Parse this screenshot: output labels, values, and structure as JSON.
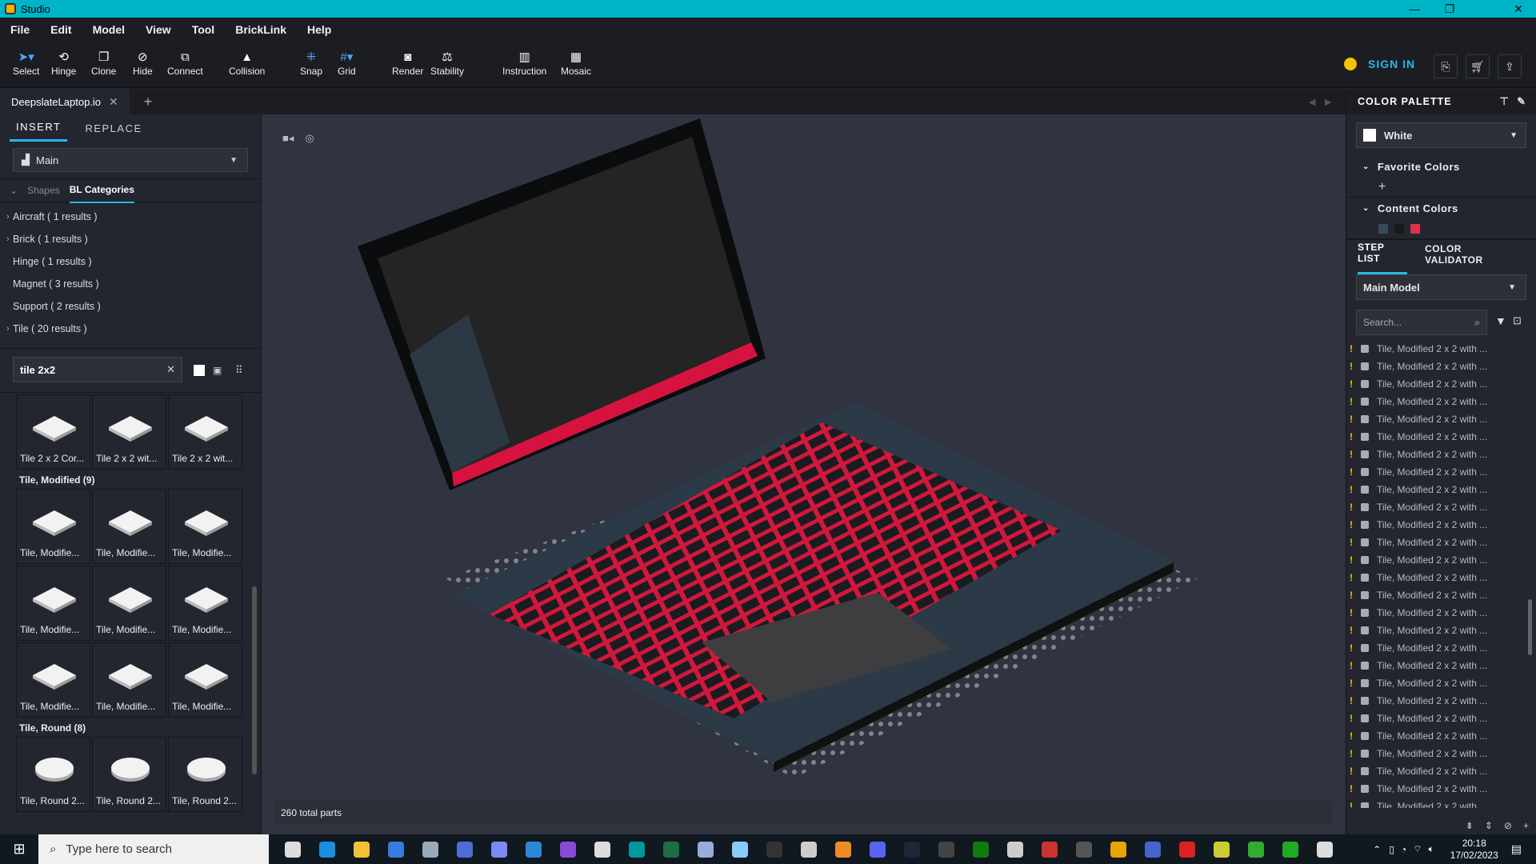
{
  "window": {
    "title": "Studio"
  },
  "menu": [
    "File",
    "Edit",
    "Model",
    "View",
    "Tool",
    "BrickLink",
    "Help"
  ],
  "toolbar": {
    "tools": [
      {
        "label": "Select",
        "icon": "cursor-icon"
      },
      {
        "label": "Hinge",
        "icon": "hinge-icon"
      },
      {
        "label": "Clone",
        "icon": "clone-icon"
      },
      {
        "label": "Hide",
        "icon": "hide-icon"
      },
      {
        "label": "Connect",
        "icon": "connect-icon"
      },
      {
        "label": "Collision",
        "icon": "collision-icon"
      },
      {
        "label": "Snap",
        "icon": "snap-icon"
      },
      {
        "label": "Grid",
        "icon": "grid-icon"
      },
      {
        "label": "Render",
        "icon": "camera-icon"
      },
      {
        "label": "Stability",
        "icon": "stability-icon"
      },
      {
        "label": "Instruction",
        "icon": "instruction-icon"
      },
      {
        "label": "Mosaic",
        "icon": "mosaic-icon"
      }
    ],
    "sign_in": "SIGN IN"
  },
  "document_tab": {
    "name": "DeepslateLaptop.io"
  },
  "left_panel": {
    "tabs": [
      "INSERT",
      "REPLACE"
    ],
    "palette": "Main",
    "category_tabs": {
      "shapes": "Shapes",
      "bl": "BL Categories"
    },
    "categories": [
      {
        "label": "Aircraft ( 1 results )",
        "expandable": true
      },
      {
        "label": "Brick ( 1 results )",
        "expandable": true
      },
      {
        "label": "Hinge ( 1 results )",
        "expandable": false
      },
      {
        "label": "Magnet ( 3 results )",
        "expandable": false
      },
      {
        "label": "Support ( 2 results )",
        "expandable": false
      },
      {
        "label": "Tile ( 20 results )",
        "expandable": true
      }
    ],
    "search": "tile 2x2",
    "groups": [
      {
        "title": "",
        "items": [
          "Tile 2 x 2 Cor...",
          "Tile 2 x 2 wit...",
          "Tile 2 x 2 wit..."
        ]
      },
      {
        "title": "Tile, Modified (9)",
        "items": [
          "Tile, Modifie...",
          "Tile, Modifie...",
          "Tile, Modifie...",
          "Tile, Modifie...",
          "Tile, Modifie...",
          "Tile, Modifie...",
          "Tile, Modifie...",
          "Tile, Modifie...",
          "Tile, Modifie..."
        ]
      },
      {
        "title": "Tile, Round (8)",
        "items": [
          "Tile, Round 2...",
          "Tile, Round 2...",
          "Tile, Round 2..."
        ]
      }
    ]
  },
  "viewport": {
    "status": "260 total parts"
  },
  "right_panel": {
    "color_palette_title": "COLOR PALETTE",
    "selected_color": "White",
    "favorite_colors": "Favorite Colors",
    "content_colors": "Content Colors",
    "content_swatches": [
      "#3a4a5a",
      "#1a1a1a",
      "#e0304a"
    ],
    "tabs": [
      "STEP LIST",
      "COLOR VALIDATOR"
    ],
    "model": "Main Model",
    "search_placeholder": "Search...",
    "step_item": "Tile, Modified 2 x 2 with ...",
    "step_count": 27
  },
  "taskbar": {
    "search_placeholder": "Type here to search",
    "time": "20:18",
    "date": "17/02/2023",
    "icons": [
      "task-view-icon",
      "edge-icon",
      "explorer-icon",
      "store-icon",
      "app-icon",
      "app-icon",
      "app-icon",
      "vscode-icon",
      "visualstudio-icon",
      "github-icon",
      "arduino-icon",
      "excel-icon",
      "app-icon",
      "app-icon",
      "terminal-icon",
      "app-icon",
      "blender-icon",
      "discord-icon",
      "steam-icon",
      "obs-icon",
      "xbox-icon",
      "app-icon",
      "app-icon",
      "app-icon",
      "wow-icon",
      "app-icon",
      "app-icon",
      "app-icon",
      "studio-icon",
      "app-icon",
      "unity-icon"
    ],
    "icon_colors": [
      "#ddd",
      "#1a8fe0",
      "#f2c233",
      "#3a7be0",
      "#9ab",
      "#4b6fd6",
      "#7a8af0",
      "#2b88d8",
      "#8a4ad8",
      "#ddd",
      "#00979d",
      "#1d6f42",
      "#9ad",
      "#8cf",
      "#333",
      "#ccc",
      "#f08a24",
      "#5865f2",
      "#1b2838",
      "#444",
      "#107c10",
      "#ccc",
      "#c33",
      "#555",
      "#e8a400",
      "#46c",
      "#d22",
      "#cc3",
      "#3a3",
      "#2a2",
      "#ddd"
    ]
  }
}
